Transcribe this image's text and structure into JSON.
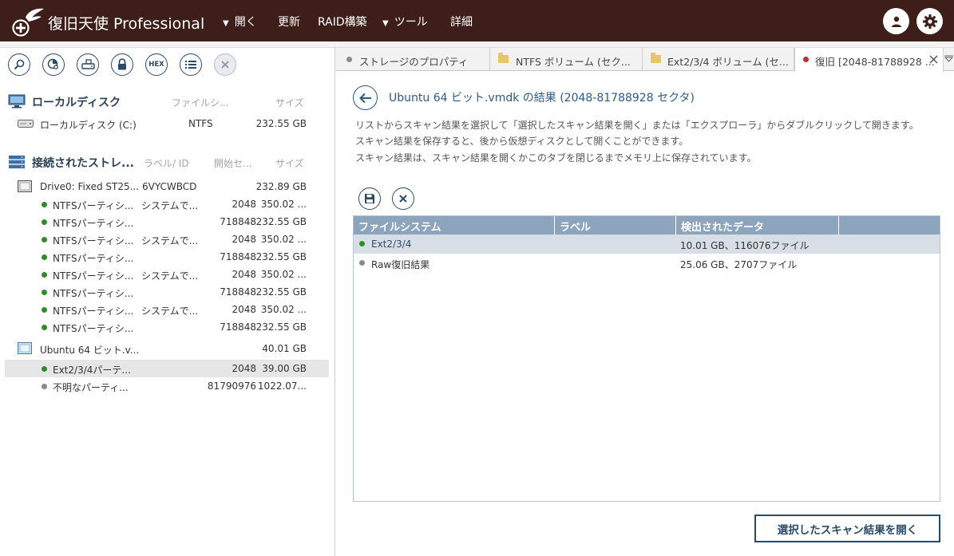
{
  "app": {
    "title": "復旧天使 Professional"
  },
  "menu": {
    "open": "開く",
    "refresh": "更新",
    "raid": "RAID構築",
    "tools": "ツール",
    "details": "詳細"
  },
  "toolbar": {
    "hex_label": "HEX"
  },
  "local_disks": {
    "title": "ローカルディスク",
    "col_fs": "ファイルシ...",
    "col_size": "サイズ",
    "items": [
      {
        "name": "ローカルディスク (C:)",
        "fs": "NTFS",
        "size": "232.55 GB"
      }
    ]
  },
  "connected": {
    "title": "接続されたストレ...",
    "col_label": "ラベル/ ID",
    "col_start": "開始セ...",
    "col_size": "サイズ",
    "drive0": {
      "name": "Drive0: Fixed ST25...",
      "id": "6VYCWBCD",
      "size": "232.89 GB"
    },
    "partitions": [
      {
        "name": "NTFSパーティシ...",
        "label": "システムで...",
        "start": "2048",
        "size": "350.02 ..."
      },
      {
        "name": "NTFSパーティシ...",
        "label": "",
        "start": "718848",
        "size": "232.55 GB"
      },
      {
        "name": "NTFSパーティシ...",
        "label": "システムで...",
        "start": "2048",
        "size": "350.02 ..."
      },
      {
        "name": "NTFSパーティシ...",
        "label": "",
        "start": "718848",
        "size": "232.55 GB"
      },
      {
        "name": "NTFSパーティシ...",
        "label": "システムで...",
        "start": "2048",
        "size": "350.02 ..."
      },
      {
        "name": "NTFSパーティシ...",
        "label": "",
        "start": "718848",
        "size": "232.55 GB"
      },
      {
        "name": "NTFSパーティシ...",
        "label": "システムで...",
        "start": "2048",
        "size": "350.02 ..."
      },
      {
        "name": "NTFSパーティシ...",
        "label": "",
        "start": "718848",
        "size": "232.55 GB"
      }
    ],
    "vmdk": {
      "name": "Ubuntu 64 ビット.v...",
      "size": "40.01 GB"
    },
    "vmdk_partitions": [
      {
        "name": "Ext2/3/4パーテ...",
        "start": "2048",
        "size": "39.00 GB"
      },
      {
        "name": "不明なパーティ...",
        "start": "81790976",
        "size": "1022.07..."
      }
    ]
  },
  "tabs": [
    {
      "label": "ストレージのプロパティ"
    },
    {
      "label": "NTFS ボリューム (セク..."
    },
    {
      "label": "Ext2/3/4 ボリューム (セ..."
    },
    {
      "label": "復旧 [2048-81788928 ..."
    }
  ],
  "result": {
    "title": "Ubuntu 64 ビット.vmdk の結果 (2048-81788928 セクタ)",
    "desc1": "リストからスキャン結果を選択して「選択したスキャン結果を開く」または「エクスプローラ」からダブルクリックして開きます。",
    "desc2": "スキャン結果を保存すると、後から仮想ディスクとして開くことができます。",
    "desc3": "スキャン結果は、スキャン結果を開くかこのタブを閉じるまでメモリ上に保存されています。",
    "columns": [
      "ファイルシステム",
      "ラベル",
      "検出されたデータ"
    ],
    "rows": [
      {
        "fs": "Ext2/3/4",
        "label": "",
        "data": "10.01 GB、116076ファイル"
      },
      {
        "fs": "Raw復旧結果",
        "label": "",
        "data": "25.06 GB、2707ファイル"
      }
    ],
    "open_button": "選択したスキャン結果を開く"
  },
  "colors": {
    "topbar": "#3e1e18",
    "accent": "#2a4a6a",
    "green": "#2e8b2e",
    "gray": "#8a8a8a",
    "red": "#c0302a",
    "folder": "#e8c46a"
  }
}
